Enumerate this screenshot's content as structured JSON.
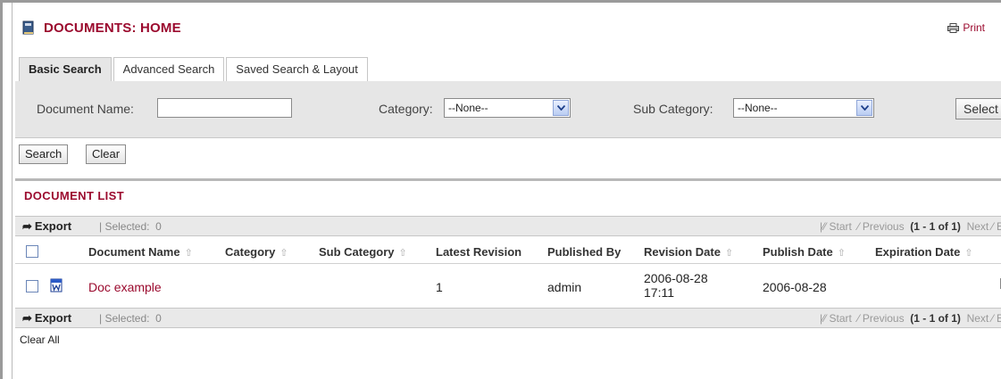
{
  "header": {
    "title": "DOCUMENTS: HOME",
    "print_label": "Print"
  },
  "tabs": [
    {
      "label": "Basic Search",
      "active": true
    },
    {
      "label": "Advanced Search",
      "active": false
    },
    {
      "label": "Saved Search & Layout",
      "active": false
    }
  ],
  "search": {
    "doc_name_label": "Document Name:",
    "doc_name_value": "",
    "category_label": "Category:",
    "category_value": "--None--",
    "subcategory_label": "Sub Category:",
    "subcategory_value": "--None--",
    "select_button": "Select"
  },
  "actions": {
    "search": "Search",
    "clear": "Clear"
  },
  "list": {
    "title": "DOCUMENT LIST",
    "export_label": "Export",
    "selected_label": "Selected:",
    "selected_count": "0",
    "pager": {
      "start": "Start",
      "previous": "Previous",
      "range": "(1 - 1 of 1)",
      "next": "Next",
      "end": "E"
    },
    "columns": [
      "Document Name",
      "Category",
      "Sub Category",
      "Latest Revision",
      "Published By",
      "Revision Date",
      "Publish Date",
      "Expiration Date"
    ],
    "rows": [
      {
        "document_name": "Doc example",
        "category": "",
        "sub_category": "",
        "latest_revision": "1",
        "published_by": "admin",
        "revision_date_line1": "2006-08-28",
        "revision_date_line2": "17:11",
        "publish_date": "2006-08-28",
        "expiration_date": ""
      }
    ]
  },
  "footer": {
    "clear_all": "Clear All"
  },
  "colors": {
    "accent": "#9b0a2e",
    "panel": "#e6e6e6"
  }
}
